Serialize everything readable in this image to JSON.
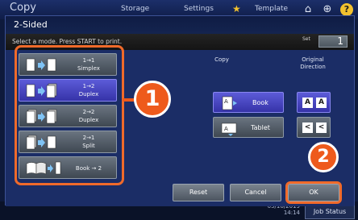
{
  "header": {
    "app_title": "Copy",
    "tabs": [
      "Storage",
      "Settings",
      "Template"
    ],
    "icons": [
      "star-icon",
      "home-icon",
      "globe-icon",
      "help-icon"
    ],
    "help_label": "?"
  },
  "dialog": {
    "title": "2-Sided",
    "instruction": "Select a mode. Press START to print.",
    "set_label": "Set",
    "set_value": "1"
  },
  "modes": [
    {
      "line1": "1→1",
      "line2": "Simplex",
      "selected": false
    },
    {
      "line1": "1→2",
      "line2": "Duplex",
      "selected": true
    },
    {
      "line1": "2→2",
      "line2": "Duplex",
      "selected": false
    },
    {
      "line1": "2→1",
      "line2": "Split",
      "selected": false
    },
    {
      "line1": "Book → 2",
      "line2": "",
      "selected": false
    }
  ],
  "copy": {
    "label": "Copy",
    "options": [
      {
        "label": "Book",
        "selected": true
      },
      {
        "label": "Tablet",
        "selected": false
      }
    ]
  },
  "original_direction": {
    "label_line1": "Original",
    "label_line2": "Direction",
    "options": [
      {
        "glyphs": [
          "A",
          "A"
        ],
        "selected": true
      },
      {
        "glyphs": [
          "<",
          "<"
        ],
        "selected": false
      }
    ]
  },
  "footer": {
    "reset_label": "Reset",
    "cancel_label": "Cancel",
    "ok_label": "OK"
  },
  "status": {
    "date": "05/16/2019",
    "time": "14:14",
    "job_status_label": "Job Status"
  },
  "callouts": [
    "1",
    "2"
  ],
  "colors": {
    "accent_orange": "#ee5a1c",
    "selected_blue": "#4a48c8",
    "dialog_bg": "#1b2d66"
  }
}
